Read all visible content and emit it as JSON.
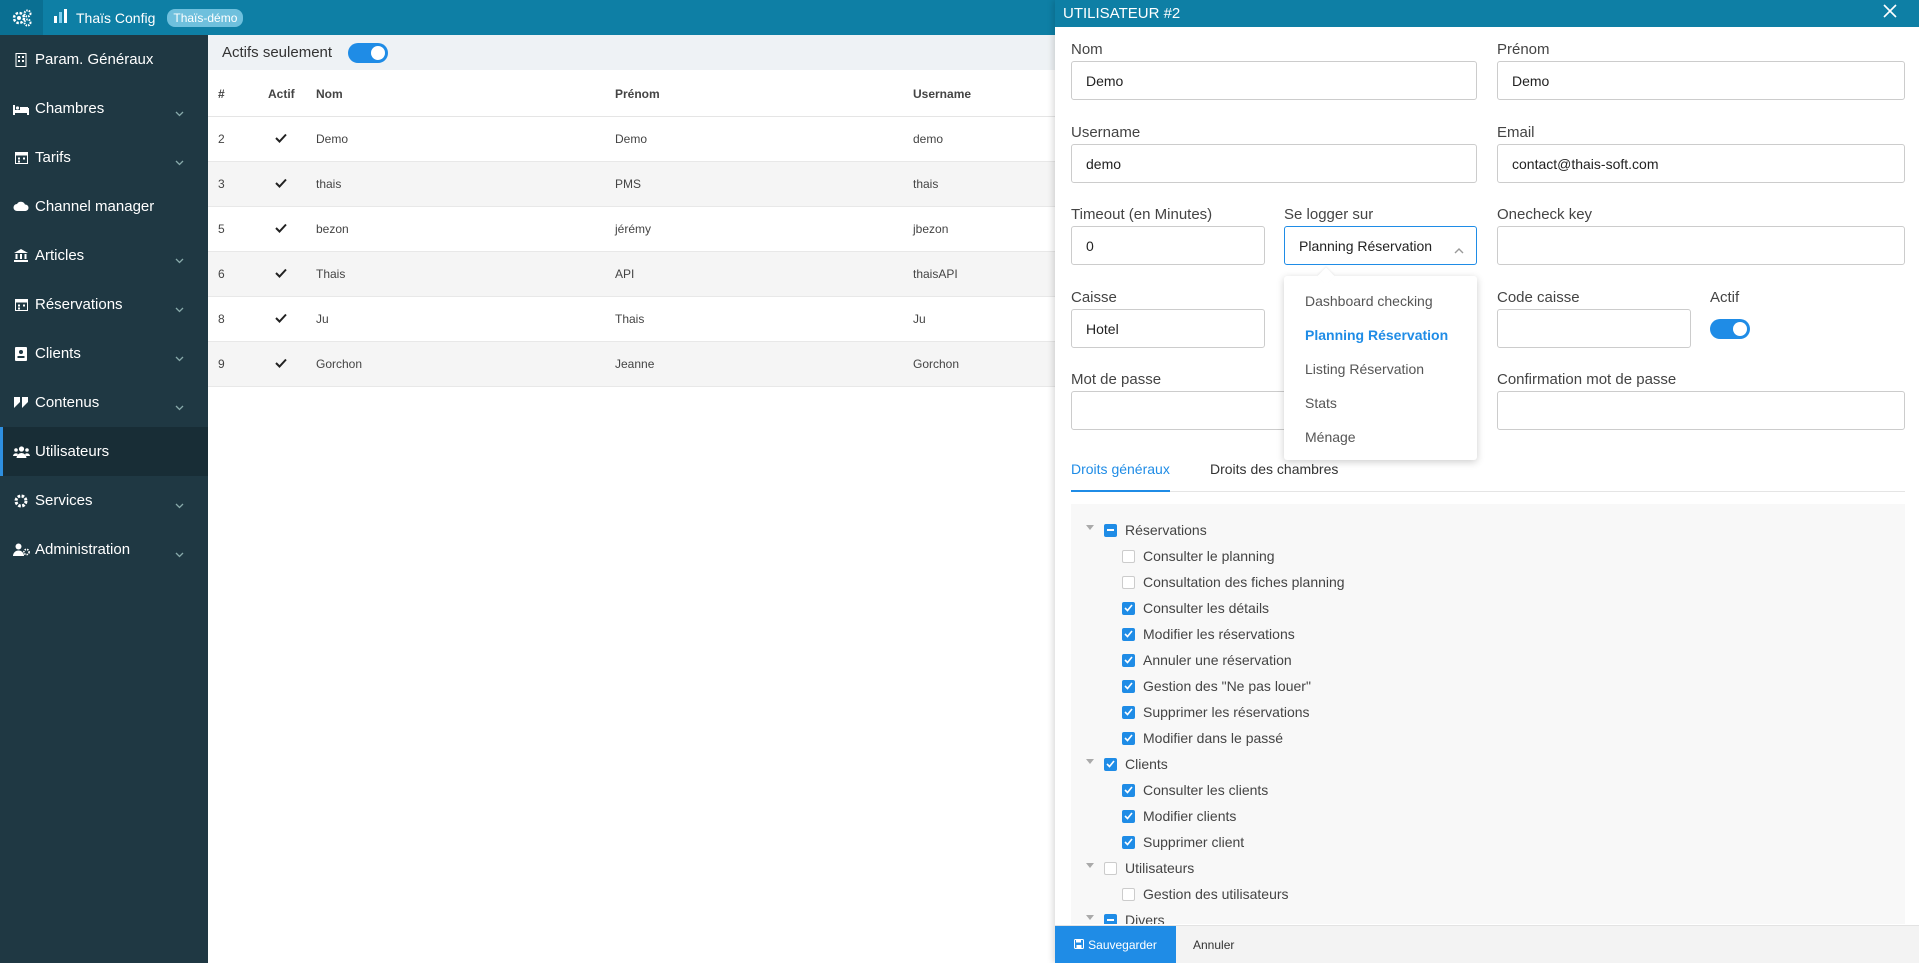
{
  "topbar": {
    "app_title": "Thaïs Config",
    "badge": "Thaïs-démo",
    "cog_icon": "cogs-icon",
    "brand_icon": "chart-icon"
  },
  "sidebar": {
    "items": [
      {
        "label": "Param. Généraux",
        "icon": "building-icon",
        "has_chevron": false
      },
      {
        "label": "Chambres",
        "icon": "bed-icon",
        "has_chevron": true
      },
      {
        "label": "Tarifs",
        "icon": "calendar-icon",
        "has_chevron": true
      },
      {
        "label": "Channel manager",
        "icon": "cloud-icon",
        "has_chevron": false
      },
      {
        "label": "Articles",
        "icon": "bank-icon",
        "has_chevron": true
      },
      {
        "label": "Réservations",
        "icon": "calendar-icon",
        "has_chevron": true
      },
      {
        "label": "Clients",
        "icon": "id-card-icon",
        "has_chevron": true
      },
      {
        "label": "Contenus",
        "icon": "quote-icon",
        "has_chevron": true
      },
      {
        "label": "Utilisateurs",
        "icon": "users-icon",
        "has_chevron": false,
        "active": true
      },
      {
        "label": "Services",
        "icon": "gear-icon",
        "has_chevron": true
      },
      {
        "label": "Administration",
        "icon": "user-cog-icon",
        "has_chevron": true
      }
    ]
  },
  "list": {
    "filter_label": "Actifs seulement",
    "filter_on": true,
    "columns": [
      "#",
      "Actif",
      "Nom",
      "Prénom",
      "Username"
    ],
    "rows": [
      {
        "id": "2",
        "nom": "Demo",
        "prenom": "Demo",
        "username": "demo"
      },
      {
        "id": "3",
        "nom": "thais",
        "prenom": "PMS",
        "username": "thais"
      },
      {
        "id": "5",
        "nom": "bezon",
        "prenom": "jérémy",
        "username": "jbezon"
      },
      {
        "id": "6",
        "nom": "Thais",
        "prenom": "API",
        "username": "thaisAPI"
      },
      {
        "id": "8",
        "nom": "Ju",
        "prenom": "Thais",
        "username": "Ju"
      },
      {
        "id": "9",
        "nom": "Gorchon",
        "prenom": "Jeanne",
        "username": "Gorchon"
      }
    ]
  },
  "panel": {
    "title": "UTILISATEUR #2",
    "fields": {
      "nom": {
        "label": "Nom",
        "value": "Demo"
      },
      "prenom": {
        "label": "Prénom",
        "value": "Demo"
      },
      "username": {
        "label": "Username",
        "value": "demo"
      },
      "email": {
        "label": "Email",
        "value": "contact@thais-soft.com"
      },
      "timeout": {
        "label": "Timeout (en Minutes)",
        "value": "0"
      },
      "logger": {
        "label": "Se logger sur",
        "value": "Planning Réservation"
      },
      "onecheck": {
        "label": "Onecheck key",
        "value": ""
      },
      "caisse": {
        "label": "Caisse",
        "value": "Hotel"
      },
      "code_caisse": {
        "label": "Code caisse",
        "value": ""
      },
      "actif": {
        "label": "Actif",
        "on": true
      },
      "mdp": {
        "label": "Mot de passe",
        "value": ""
      },
      "mdp_confirm": {
        "label": "Confirmation mot de passe",
        "value": ""
      }
    },
    "dropdown_options": [
      "Dashboard checking",
      "Planning Réservation",
      "Listing Réservation",
      "Stats",
      "Ménage"
    ],
    "dropdown_selected": "Planning Réservation",
    "tabs": [
      "Droits généraux",
      "Droits des chambres"
    ],
    "active_tab": "Droits généraux",
    "tree": [
      {
        "label": "Réservations",
        "level": 0,
        "state": "indeterminate"
      },
      {
        "label": "Consulter le planning",
        "level": 1,
        "state": "off"
      },
      {
        "label": "Consultation des fiches planning",
        "level": 1,
        "state": "off"
      },
      {
        "label": "Consulter les détails",
        "level": 1,
        "state": "on"
      },
      {
        "label": "Modifier les réservations",
        "level": 1,
        "state": "on"
      },
      {
        "label": "Annuler une réservation",
        "level": 1,
        "state": "on"
      },
      {
        "label": "Gestion des \"Ne pas louer\"",
        "level": 1,
        "state": "on"
      },
      {
        "label": "Supprimer les réservations",
        "level": 1,
        "state": "on"
      },
      {
        "label": "Modifier dans le passé",
        "level": 1,
        "state": "on"
      },
      {
        "label": "Clients",
        "level": 0,
        "state": "on"
      },
      {
        "label": "Consulter les clients",
        "level": 1,
        "state": "on"
      },
      {
        "label": "Modifier clients",
        "level": 1,
        "state": "on"
      },
      {
        "label": "Supprimer client",
        "level": 1,
        "state": "on"
      },
      {
        "label": "Utilisateurs",
        "level": 0,
        "state": "off"
      },
      {
        "label": "Gestion des utilisateurs",
        "level": 1,
        "state": "off"
      },
      {
        "label": "Divers",
        "level": 0,
        "state": "indeterminate"
      }
    ],
    "save_label": "Sauvegarder",
    "cancel_label": "Annuler"
  },
  "colors": {
    "accent": "#1f8ce6",
    "topbar": "#0e7fa5",
    "sidebar": "#1f3843"
  }
}
